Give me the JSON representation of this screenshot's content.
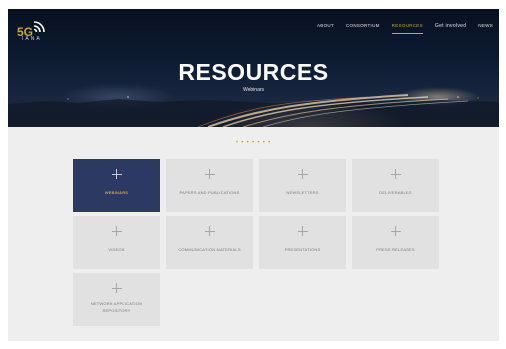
{
  "brand": {
    "logo_number": "5G",
    "logo_text": "IANA"
  },
  "nav": {
    "items": [
      {
        "label": "ABOUT",
        "active": false
      },
      {
        "label": "CONSORTIUM",
        "active": false
      },
      {
        "label": "RESOURCES",
        "active": true
      },
      {
        "label": "Get involved",
        "active": false
      },
      {
        "label": "NEWS",
        "active": false
      }
    ]
  },
  "hero": {
    "title": "RESOURCES",
    "subtitle": "Webinars"
  },
  "divider": "• • • • • • •",
  "tiles": [
    {
      "label": "WEBINARS",
      "active": true
    },
    {
      "label": "PAPERS AND PUBLICATIONS",
      "active": false
    },
    {
      "label": "NEWSLETTERS",
      "active": false
    },
    {
      "label": "DELIVERABLES",
      "active": false
    },
    {
      "label": "VIDEOS",
      "active": false
    },
    {
      "label": "COMMUNICATION MATERIALS",
      "active": false
    },
    {
      "label": "PRESENTATIONS",
      "active": false
    },
    {
      "label": "PRESS RELEASES",
      "active": false
    },
    {
      "label": "NETWORK APPLICATION REPOSITORY",
      "active": false
    }
  ],
  "colors": {
    "accent": "#c9a830",
    "active_tile": "#2c3a63",
    "tile": "#e1e1e1",
    "background": "#eeeeee"
  }
}
